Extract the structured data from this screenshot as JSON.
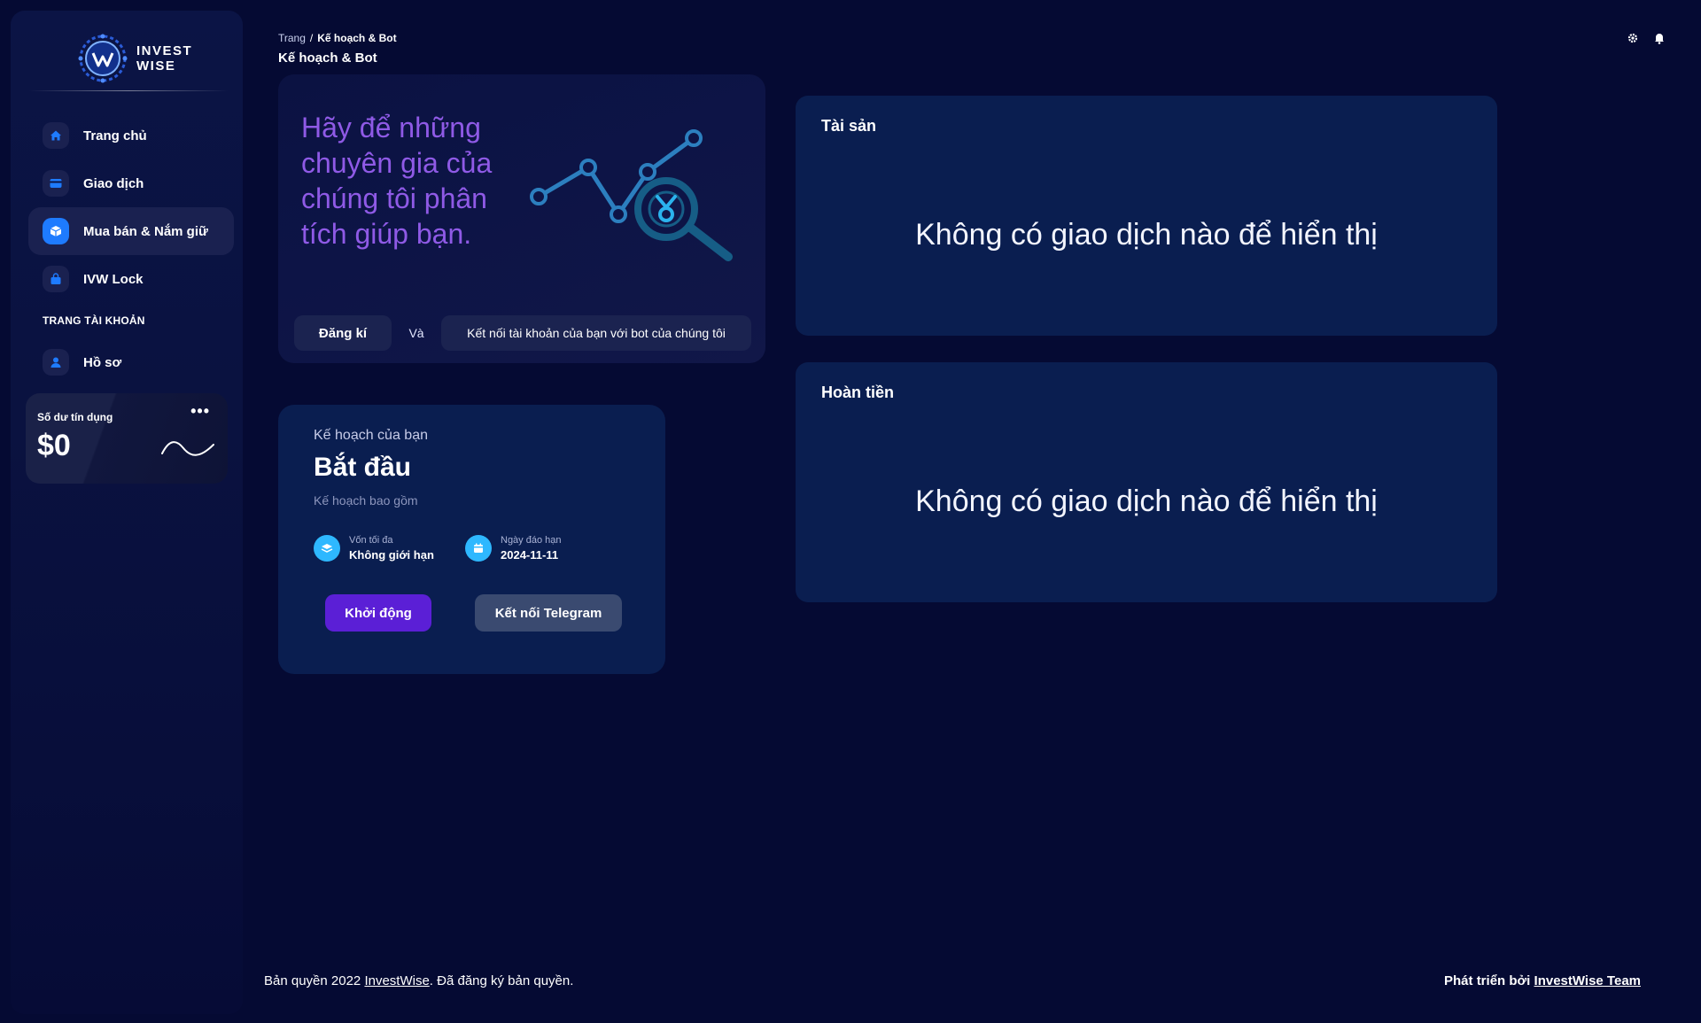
{
  "brand": {
    "line1": "INVEST",
    "line2": "WISE"
  },
  "sidebar": {
    "items": [
      {
        "label": "Trang chủ",
        "icon": "home-icon"
      },
      {
        "label": "Giao dịch",
        "icon": "card-icon"
      },
      {
        "label": "Mua bán & Nắm giữ",
        "icon": "cube-icon",
        "active": true
      },
      {
        "label": "IVW Lock",
        "icon": "bag-icon"
      }
    ],
    "section_title": "TRANG TÀI KHOẢN",
    "account_items": [
      {
        "label": "Hồ sơ",
        "icon": "user-icon"
      }
    ],
    "credit": {
      "label": "Số dư tín dụng",
      "value": "$0",
      "more": "•••"
    }
  },
  "header": {
    "breadcrumb_root": "Trang",
    "breadcrumb_sep": "/",
    "breadcrumb_current": "Kế hoạch & Bot",
    "title": "Kế hoạch & Bot"
  },
  "hero": {
    "text": "Hãy để những chuyên gia của chúng tôi phân tích giúp bạn.",
    "register_label": "Đăng kí",
    "and_label": "Và",
    "connect_bot_label": "Kết nối tài khoản của bạn với bot của chúng tôi"
  },
  "plan": {
    "subtitle": "Kế hoạch của bạn",
    "name": "Bắt đầu",
    "includes": "Kế hoạch bao gồm",
    "features": [
      {
        "label": "Vốn tối đa",
        "value": "Không giới hạn",
        "icon": "stack-icon"
      },
      {
        "label": "Ngày đáo hạn",
        "value": "2024-11-11",
        "icon": "calendar-icon"
      }
    ],
    "start_label": "Khởi động",
    "telegram_label": "Kết nối Telegram"
  },
  "panels": {
    "assets": {
      "title": "Tài sản",
      "empty": "Không có giao dịch nào để hiển thị"
    },
    "refund": {
      "title": "Hoàn tiền",
      "empty": "Không có giao dịch nào để hiển thị"
    }
  },
  "footer": {
    "left_prefix": "Bản quyền 2022 ",
    "left_link": "InvestWise",
    "left_suffix": ". Đã đăng ký bản quyền.",
    "right_prefix": "Phát triển bởi ",
    "right_link": "InvestWise Team"
  },
  "colors": {
    "background": "#050a33",
    "card": "#0a1e50",
    "accent_blue": "#1e7bff",
    "hero_text": "#8f5ae6",
    "primary_button": "#5b1fd6",
    "secondary_button": "#3a4a70"
  }
}
